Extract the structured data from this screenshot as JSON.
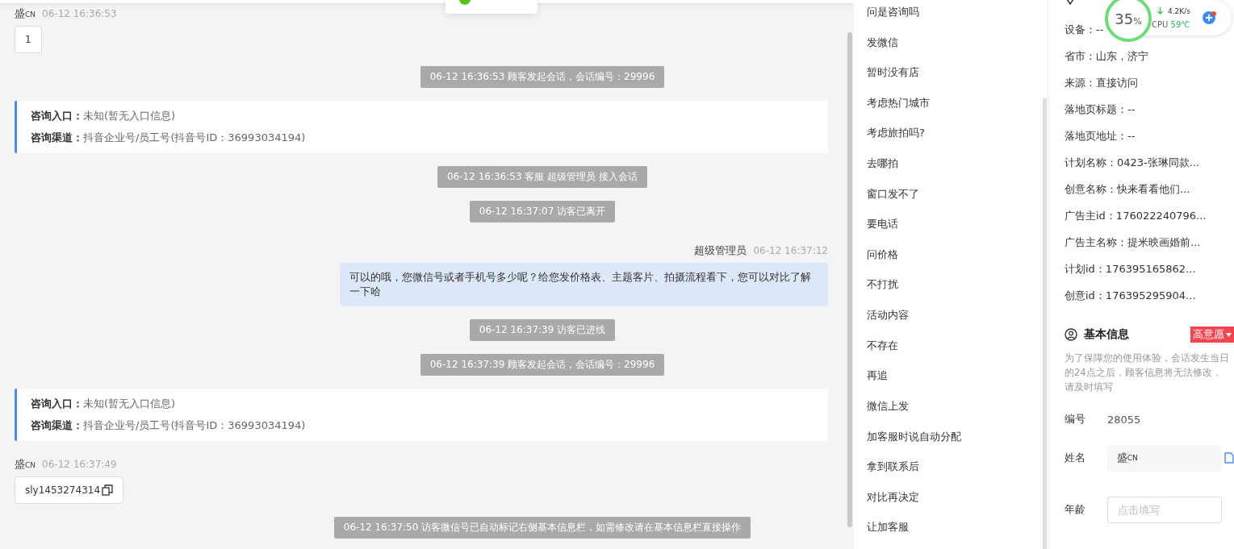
{
  "messages": [
    {
      "kind": "visitor",
      "name": "盛",
      "name_suffix": "CN",
      "time": "06-12 16:36:53",
      "text": "1",
      "copy": false
    },
    {
      "kind": "system",
      "text": "06-12 16:36:53 顾客发起会话，会话编号：29996"
    },
    {
      "kind": "info",
      "lines": [
        {
          "label": "咨询入口：",
          "value": "未知(暂无入口信息)"
        },
        {
          "label": "咨询渠道：",
          "value": "抖音企业号/员工号(抖音号ID：36993034194)"
        }
      ]
    },
    {
      "kind": "system",
      "text": "06-12 16:36:53 客服 超级管理员 接入会话"
    },
    {
      "kind": "system",
      "text": "06-12 16:37:07 访客已离开"
    },
    {
      "kind": "agent",
      "name": "超级管理员",
      "time": "06-12 16:37:12",
      "text": "可以的哦，您微信号或者手机号多少呢？给您发价格表、主题客片、拍摄流程看下，您可以对比了解一下哈"
    },
    {
      "kind": "system",
      "text": "06-12 16:37:39 访客已进线"
    },
    {
      "kind": "system",
      "text": "06-12 16:37:39 顾客发起会话，会话编号：29996"
    },
    {
      "kind": "info",
      "lines": [
        {
          "label": "咨询入口：",
          "value": "未知(暂无入口信息)"
        },
        {
          "label": "咨询渠道：",
          "value": "抖音企业号/员工号(抖音号ID：36993034194)"
        }
      ]
    },
    {
      "kind": "visitor",
      "name": "盛",
      "name_suffix": "CN",
      "time": "06-12 16:37:49",
      "text": "sly1453274314",
      "copy": true
    },
    {
      "kind": "system",
      "text": "06-12 16:37:50 访客微信号已自动标记右侧基本信息栏，如需修改请在基本信息栏直接操作"
    }
  ],
  "quick_replies": [
    "问是咨询吗",
    "发微信",
    "暂时没有店",
    "考虑热门城市",
    "考虑旅拍吗?",
    "去哪拍",
    "窗口发不了",
    "要电话",
    "问价格",
    "不打扰",
    "活动内容",
    "不存在",
    "再追",
    "微信上发",
    "加客服时说自动分配",
    "拿到联系后",
    "对比再决定",
    "让加客服"
  ],
  "source_info": [
    "设备：--",
    "省市：山东，济宁",
    "来源：直接访问",
    "落地页标题：--",
    "落地页地址：--",
    "计划名称：0423-张琳同款...",
    "创意名称：快来看看他们...",
    "广告主id：176022240796...",
    "广告主名称：提米映画婚前...",
    "计划id：176395165862...",
    "创意id：176395295904..."
  ],
  "basic_info": {
    "title": "基本信息",
    "intent_tag": "高意愿",
    "notice": "为了保障您的使用体验，会话发生当日的24点之后，顾客信息将无法修改，请及时填写",
    "fields": [
      {
        "kind": "text",
        "label": "编号",
        "value": "28055"
      },
      {
        "kind": "filled",
        "label": "姓名",
        "value": "盛",
        "value_suffix": "CN"
      },
      {
        "kind": "input",
        "label": "年龄",
        "placeholder": "点击填写"
      }
    ]
  },
  "monitor": {
    "percent": "35",
    "unit": "%",
    "net_speed": "4.2K/s",
    "cpu_label": "CPU",
    "cpu_temp": "59℃"
  }
}
